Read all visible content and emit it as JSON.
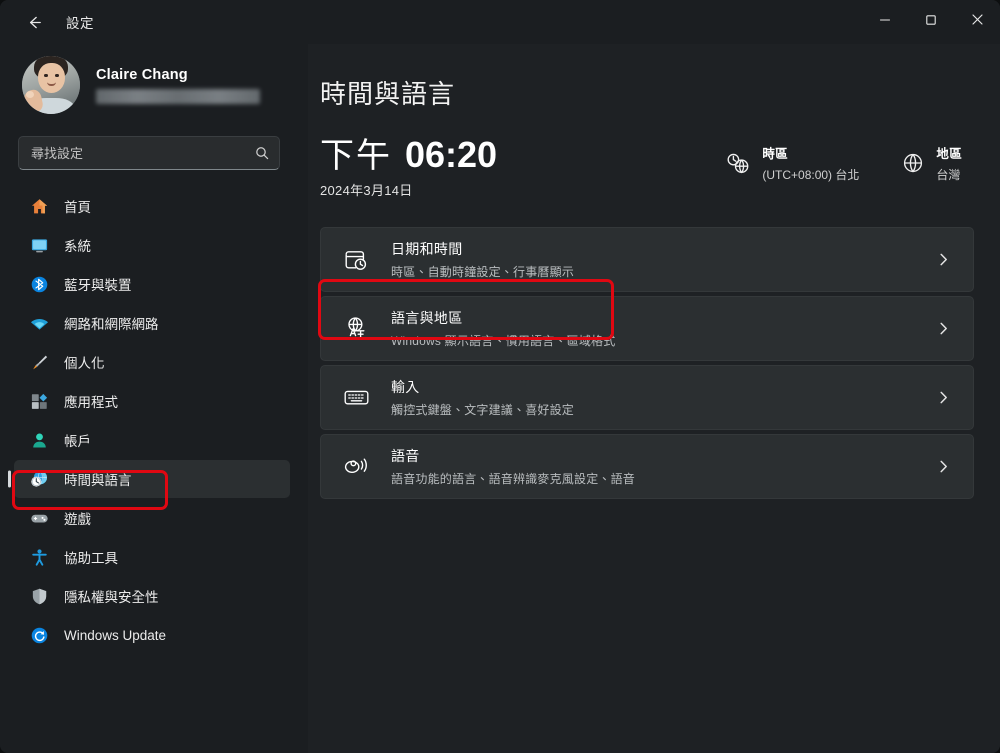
{
  "window": {
    "app_title": "設定",
    "back_icon": "arrow-left-icon",
    "controls": {
      "minimize": "minimize-icon",
      "maximize": "maximize-icon",
      "close": "close-icon"
    }
  },
  "sidebar": {
    "account": {
      "name": "Claire Chang",
      "email_redacted": "",
      "avatar": "user-avatar-photo"
    },
    "search": {
      "placeholder": "尋找設定",
      "value": "",
      "icon": "search-icon"
    },
    "items": [
      {
        "label": "首頁",
        "icon": "home-icon",
        "selected": false
      },
      {
        "label": "系統",
        "icon": "system-display-icon",
        "selected": false
      },
      {
        "label": "藍牙與裝置",
        "icon": "bluetooth-icon",
        "selected": false
      },
      {
        "label": "網路和網際網路",
        "icon": "wifi-icon",
        "selected": false
      },
      {
        "label": "個人化",
        "icon": "paintbrush-icon",
        "selected": false
      },
      {
        "label": "應用程式",
        "icon": "apps-icon",
        "selected": false
      },
      {
        "label": "帳戶",
        "icon": "account-person-icon",
        "selected": false
      },
      {
        "label": "時間與語言",
        "icon": "clock-globe-icon",
        "selected": true
      },
      {
        "label": "遊戲",
        "icon": "gamepad-icon",
        "selected": false
      },
      {
        "label": "協助工具",
        "icon": "accessibility-icon",
        "selected": false
      },
      {
        "label": "隱私權與安全性",
        "icon": "shield-icon",
        "selected": false
      },
      {
        "label": "Windows Update",
        "icon": "update-refresh-icon",
        "selected": false
      }
    ]
  },
  "main": {
    "page_title": "時間與語言",
    "clock": {
      "ampm": "下午",
      "time": "06:20",
      "date": "2024年3月14日"
    },
    "timezone": {
      "icon": "clock-globe-icon",
      "title": "時區",
      "value": "(UTC+08:00) 台北"
    },
    "region": {
      "icon": "globe-icon",
      "title": "地區",
      "value": "台灣"
    },
    "cards": [
      {
        "title": "日期和時間",
        "subtitle": "時區、自動時鐘設定、行事曆顯示",
        "icon": "calendar-clock-icon",
        "chevron": "chevron-right-icon",
        "highlighted": false
      },
      {
        "title": "語言與地區",
        "subtitle": "Windows 顯示語言、慣用語言、區域格式",
        "icon": "translate-globe-icon",
        "chevron": "chevron-right-icon",
        "highlighted": true
      },
      {
        "title": "輸入",
        "subtitle": "觸控式鍵盤、文字建議、喜好設定",
        "icon": "keyboard-icon",
        "chevron": "chevron-right-icon",
        "highlighted": false
      },
      {
        "title": "語音",
        "subtitle": "語音功能的語言、語音辨識麥克風設定、語音",
        "icon": "speech-icon",
        "chevron": "chevron-right-icon",
        "highlighted": false
      }
    ]
  },
  "annotations": {
    "color": "#e00812",
    "sidebar_target": "時間與語言",
    "card_target": "語言與地區"
  }
}
